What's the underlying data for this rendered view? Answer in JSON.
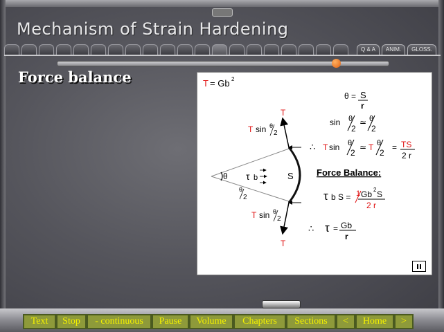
{
  "header": {
    "title": "Mechanism of Strain Hardening",
    "tabs": [
      "Q & A",
      "ANIM.",
      "GLOSS."
    ]
  },
  "progress": {
    "value": 0.845
  },
  "slide": {
    "heading": "Force balance"
  },
  "diagram": {
    "eq_top_T": "T",
    "eq_top_rest": "= Gb",
    "eq_top_exp": "2",
    "theta_def": "θ =",
    "frac_S": "S",
    "frac_r": "r",
    "sin": "sin",
    "approx": "≃",
    "theta": "θ",
    "two": "2",
    "therefore": "∴",
    "T": "T",
    "Tsin": "T sin",
    "equals": "=",
    "TS_num": "TS",
    "TS_den": "2 r",
    "force_balance": "Force Balance:",
    "tau": "τ",
    "b": "b",
    "S": "S",
    "bS_eq": "b S =",
    "Gb2S": "Gb",
    "Gb2S_exp": "2",
    "Gb2S_S": "S",
    "two_r": "2 r",
    "one": "1",
    "final_lhs": "τ",
    "final_eq": "=",
    "Gb": "Gb",
    "r": "r",
    "arc_S": "S"
  },
  "nav": {
    "buttons": [
      "Text",
      "Stop",
      "- continuous",
      "Pause",
      "Volume",
      "Chapters",
      "Sections",
      "<",
      "Home",
      ">"
    ]
  },
  "colors": {
    "accent_red": "#e01010",
    "nav_text": "#f6f200",
    "nav_bg": "#8e9a3a",
    "progress_knob": "#f07a20"
  }
}
